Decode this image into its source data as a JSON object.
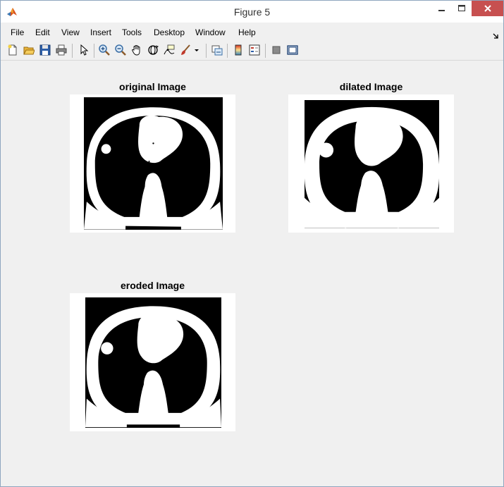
{
  "window": {
    "title": "Figure 5",
    "app_icon": "matlab-icon",
    "controls": [
      "minimize-icon",
      "maximize-icon",
      "close-icon"
    ]
  },
  "menu": {
    "items": [
      {
        "label": "File"
      },
      {
        "label": "Edit"
      },
      {
        "label": "View"
      },
      {
        "label": "Insert"
      },
      {
        "label": "Tools"
      },
      {
        "label": "Desktop"
      },
      {
        "label": "Window"
      },
      {
        "label": "Help"
      }
    ],
    "dock_icon": "dock-arrow-icon"
  },
  "toolbar": {
    "icons": [
      "new-figure-icon",
      "open-file-icon",
      "save-icon",
      "print-icon",
      "edit-plot-arrow-icon",
      "zoom-in-icon",
      "zoom-out-icon",
      "pan-hand-icon",
      "rotate-3d-icon",
      "data-cursor-icon",
      "brush-icon",
      "brush-dropdown-icon",
      "link-plot-icon",
      "colorbar-icon",
      "legend-icon",
      "hide-plot-tools-icon",
      "show-plot-tools-icon"
    ]
  },
  "axes": [
    {
      "title": "original Image"
    },
    {
      "title": "dilated Image"
    },
    {
      "title": "eroded Image"
    }
  ],
  "colors": {
    "close_button": "#c75050",
    "figure_background": "#f0f0f0",
    "axes_background": "#ffffff",
    "image_background": "#000000",
    "image_foreground": "#ffffff"
  }
}
